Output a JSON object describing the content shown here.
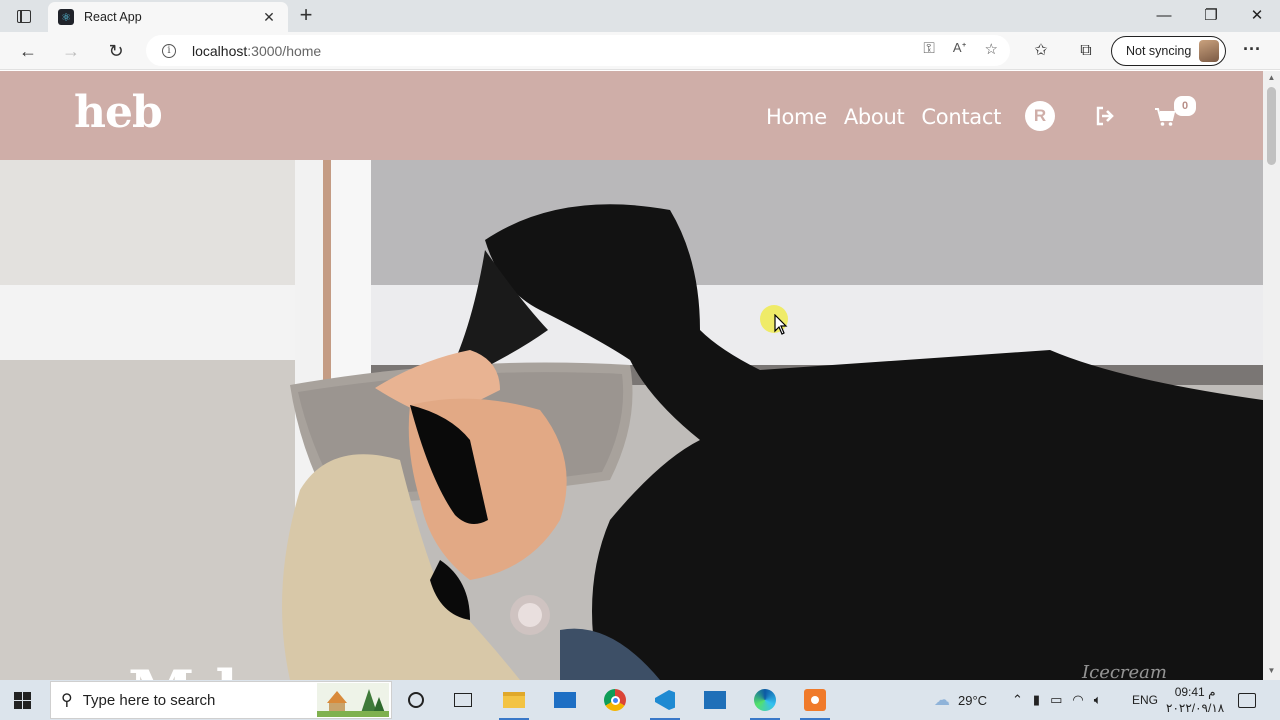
{
  "browser": {
    "tab_title": "React App",
    "url_host": "localhost",
    "url_path": ":3000/home",
    "sync_label": "Not syncing"
  },
  "site": {
    "logo": "heb",
    "nav": [
      "Home",
      "About",
      "Contact"
    ],
    "user_initial": "R",
    "cart_count": "0",
    "hero_text": "M  l"
  },
  "watermark": "Icecream",
  "taskbar": {
    "search_placeholder": "Type here to search",
    "weather": "29°C",
    "language": "ENG",
    "time": "09:41 م",
    "date": "٢٠٢٢/٠٩/١٨"
  },
  "colors": {
    "header_bg": "#cfaea8",
    "chrome_bg": "#f7f7f7",
    "taskbar_bg": "#dce4ec"
  }
}
